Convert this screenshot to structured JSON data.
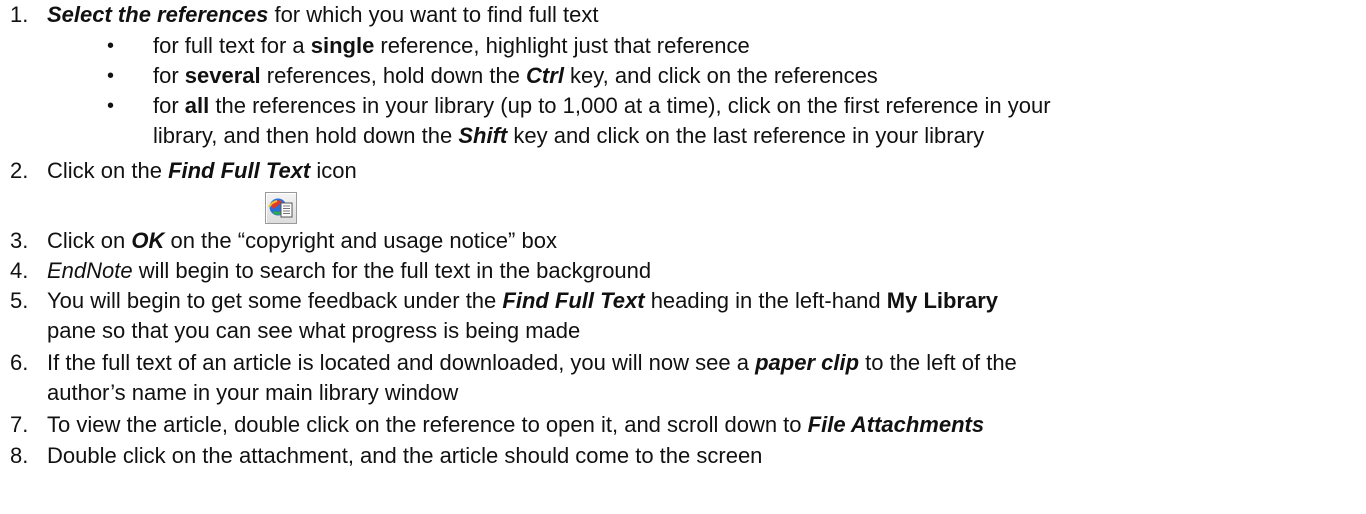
{
  "steps": [
    {
      "num": "1.",
      "parts": {
        "a": "Select the references",
        "b": " for which you want to find full text"
      },
      "bullets": [
        {
          "a": "for full text for a ",
          "b": "single",
          "c": " reference, highlight just that reference"
        },
        {
          "a": "for ",
          "b": "several",
          "c": " references, hold down the ",
          "d": "Ctrl",
          "e": " key, and click on the references"
        },
        {
          "a": "for ",
          "b": "all",
          "c": " the references in your library (up to 1,000 at a time), click on the first reference in your",
          "cont_a": "library, and then hold down the ",
          "cont_b": "Shift",
          "cont_c": " key and click on the last reference in your library"
        }
      ]
    },
    {
      "num": "2.",
      "parts": {
        "a": "Click on the ",
        "b": "Find Full Text",
        "c": " icon"
      },
      "icon": "find-full-text-icon"
    },
    {
      "num": "3.",
      "parts": {
        "a": "Click on ",
        "b": "OK",
        "c": " on the “copyright and usage notice” box"
      }
    },
    {
      "num": "4.",
      "parts": {
        "a": "EndNote",
        "b": " will begin to search for the full text in the background"
      }
    },
    {
      "num": "5.",
      "parts": {
        "a": "You will begin to get some feedback under the ",
        "b": "Find Full Text",
        "c": " heading in the left-hand ",
        "d": "My Library",
        "cont": "pane so that you can see what progress is being made"
      }
    },
    {
      "num": "6.",
      "parts": {
        "a": "If the full text of an article is located and downloaded, you will now see a ",
        "b": "paper clip",
        "c": " to the left of the",
        "cont": "author’s name in your main library window"
      }
    },
    {
      "num": "7.",
      "parts": {
        "a": "To view the article, double click on the reference to open it, and scroll down to ",
        "b": "File Attachments"
      }
    },
    {
      "num": "8.",
      "parts": {
        "a": "Double click on the attachment, and the article should come to the screen"
      }
    }
  ],
  "bullet_char": "•",
  "colors": {
    "text": "#111111",
    "icon_border": "#9a9a9a"
  }
}
